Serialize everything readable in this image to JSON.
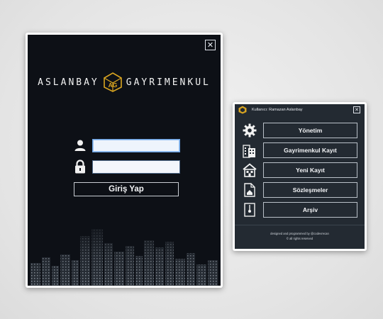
{
  "login_window": {
    "close_symbol": "✕",
    "brand": {
      "left": "ASLANBAY",
      "right": "GAYRIMENKUL",
      "logo_letters": "AG"
    },
    "username_field": {
      "value": "",
      "placeholder": "",
      "icon": "user-icon"
    },
    "password_field": {
      "value": "",
      "placeholder": "",
      "icon": "lock-icon"
    },
    "login_button_label": "Giriş Yap"
  },
  "menu_window": {
    "title_user": "Kullanıcı: Ramazan Aslanbay",
    "close_symbol": "✕",
    "items": [
      {
        "label": "Yönetim",
        "icon": "gear-icon"
      },
      {
        "label": "Gayrimenkul Kayıt",
        "icon": "buildings-icon"
      },
      {
        "label": "Yeni Kayıt",
        "icon": "house-add-icon"
      },
      {
        "label": "Sözleşmeler",
        "icon": "document-icon"
      },
      {
        "label": "Arşiv",
        "icon": "archive-icon"
      }
    ],
    "credit_line1": "designed and programmed by @codevrecan",
    "credit_line2": "© all rights reserved"
  },
  "colors": {
    "login_bg": "#0d1016",
    "menu_bg": "#232a32",
    "gold": "#d9a521",
    "page_bg": "#e8e8e8"
  }
}
